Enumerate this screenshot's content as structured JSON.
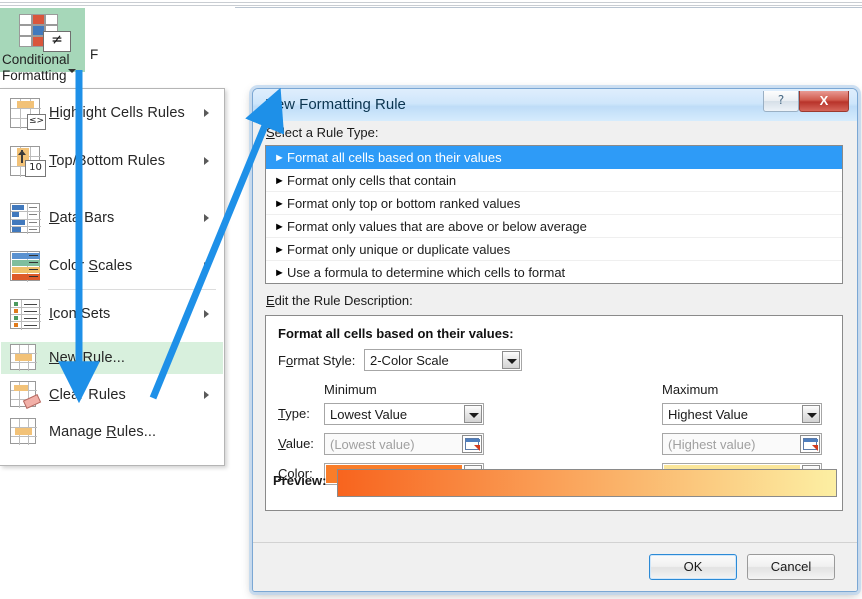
{
  "ribbon": {
    "cf_button_label": "Conditional Formatting",
    "cf_button_label_line1": "Conditional",
    "cf_button_label_line2": "Formatting",
    "cf_icon_name": "conditional-formatting-icon",
    "cf_icon_glyph": "≠",
    "neighbor_text": "F"
  },
  "menu": {
    "items": [
      {
        "label_pre": "",
        "label_key": "H",
        "label_post": "ighlight Cells Rules",
        "full": "Highlight Cells Rules",
        "icon": "highlight-cells-icon",
        "submenu": true,
        "highlighted": false
      },
      {
        "label_pre": "",
        "label_key": "T",
        "label_post": "op/Bottom Rules",
        "full": "Top/Bottom Rules",
        "icon": "top-bottom-rules-icon",
        "submenu": true,
        "highlighted": false
      },
      {
        "label_pre": "",
        "label_key": "D",
        "label_post": "ata Bars",
        "full": "Data Bars",
        "icon": "data-bars-icon",
        "submenu": true,
        "highlighted": false
      },
      {
        "label_pre": "Color ",
        "label_key": "S",
        "label_post": "cales",
        "full": "Color Scales",
        "icon": "color-scales-icon",
        "submenu": true,
        "highlighted": false
      },
      {
        "label_pre": "",
        "label_key": "I",
        "label_post": "con Sets",
        "full": "Icon Sets",
        "icon": "icon-sets-icon",
        "submenu": true,
        "highlighted": false
      },
      {
        "label_pre": "",
        "label_key": "N",
        "label_post": "ew Rule...",
        "full": "New Rule...",
        "icon": "new-rule-icon",
        "submenu": false,
        "highlighted": true
      },
      {
        "label_pre": "",
        "label_key": "C",
        "label_post": "lear Rules",
        "full": "Clear Rules",
        "icon": "clear-rules-icon",
        "submenu": true,
        "highlighted": false
      },
      {
        "label_pre": "Manage ",
        "label_key": "R",
        "label_post": "ules...",
        "full": "Manage Rules...",
        "icon": "manage-rules-icon",
        "submenu": false,
        "highlighted": false
      }
    ],
    "badge_top_bottom": "10"
  },
  "dialog": {
    "title": "New Formatting Rule",
    "help_glyph": "?",
    "close_glyph": "X",
    "select_rule_type_label": "Select a Rule Type:",
    "rule_types": [
      {
        "label": "Format all cells based on their values",
        "selected": true
      },
      {
        "label": "Format only cells that contain",
        "selected": false
      },
      {
        "label": "Format only top or bottom ranked values",
        "selected": false
      },
      {
        "label": "Format only values that are above or below average",
        "selected": false
      },
      {
        "label": "Format only unique or duplicate values",
        "selected": false
      },
      {
        "label": "Use a formula to determine which cells to format",
        "selected": false
      }
    ],
    "bullet_glyph": "►",
    "edit_rule_description_label": "Edit the Rule Description:",
    "edit_group_title": "Format all cells based on their values:",
    "format_style_label": "Format Style:",
    "format_style_value": "2-Color Scale",
    "column_minimum_label": "Minimum",
    "column_maximum_label": "Maximum",
    "type_label": "Type:",
    "value_label": "Value:",
    "color_label": "Color:",
    "preview_label": "Preview:",
    "minimum": {
      "type_value": "Lowest Value",
      "value_placeholder": "(Lowest value)",
      "value_current": "",
      "color_hex": "#F97D29"
    },
    "maximum": {
      "type_value": "Highest Value",
      "value_placeholder": "(Highest value)",
      "value_current": "",
      "color_hex": "#FAE69A"
    },
    "preview_gradient_from": "#F8641E",
    "preview_gradient_to": "#FCEFA3",
    "ok_label": "OK",
    "cancel_label": "Cancel"
  },
  "colors": {
    "ribbon_button_bg": "#A6D7B9",
    "menu_highlight_bg": "#D8F0DD",
    "selection_blue": "#2E9BF7",
    "arrow_blue": "#1E90E8",
    "title_bar_blue": "#C6E2F8",
    "close_red": "#C0392B"
  },
  "annotations": {
    "arrow_vertical_name": "arrow-pointing-to-new-rule",
    "arrow_diagonal_name": "arrow-pointing-to-dialog-title"
  }
}
